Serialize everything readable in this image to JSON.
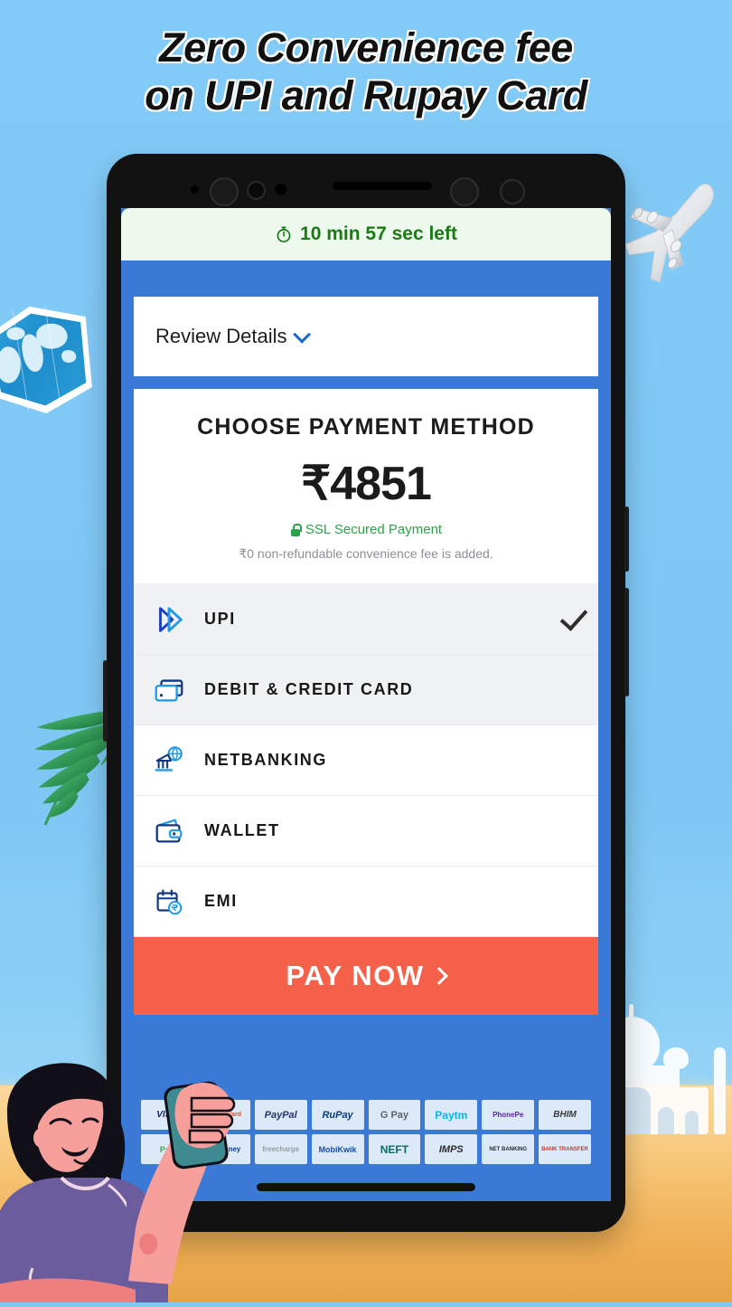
{
  "poster": {
    "headline_line1": "Zero Convenience fee",
    "headline_line2": "on UPI and Rupay Card",
    "background_color": "#80c9f5",
    "sand_color": "#f0b055"
  },
  "decorations": [
    {
      "name": "airplane",
      "color": "#ffffff"
    },
    {
      "name": "world-map",
      "color": "#2a9ed6"
    },
    {
      "name": "palm-leaf",
      "color": "#2e9e55"
    },
    {
      "name": "taj-mahal",
      "color": "#ffffff"
    },
    {
      "name": "woman-with-phone",
      "color": "#f49a9a"
    }
  ],
  "app": {
    "background_color": "#3a7ad6",
    "timer": {
      "icon": "stopwatch-icon",
      "text": "10 min 57 sec left",
      "text_color": "#1a7a14",
      "background_color": "#edf9ec"
    },
    "review": {
      "label": "Review Details",
      "chevron": "chevron-down-icon"
    },
    "payment": {
      "title": "CHOOSE PAYMENT METHOD",
      "amount": "₹4851",
      "ssl_text": "SSL Secured Payment",
      "ssl_color": "#2aa34a",
      "ssl_icon": "lock-icon",
      "fee_note": "₹0 non-refundable convenience fee is added."
    },
    "methods": [
      {
        "label": "UPI",
        "icon": "upi-icon",
        "selected": true,
        "check": "check-icon"
      },
      {
        "label": "DEBIT & CREDIT CARD",
        "icon": "credit-card-icon",
        "selected": true,
        "check": ""
      },
      {
        "label": "NETBANKING",
        "icon": "netbanking-icon",
        "selected": false,
        "check": ""
      },
      {
        "label": "WALLET",
        "icon": "wallet-icon",
        "selected": false,
        "check": ""
      },
      {
        "label": "EMI",
        "icon": "emi-calendar-icon",
        "selected": false,
        "check": ""
      }
    ],
    "pay_button": {
      "label": "PAY NOW",
      "chevron": "chevron-right-icon",
      "color": "#f4604a"
    },
    "logos_row1": [
      "VISA",
      "MasterCard",
      "PayPal",
      "RuPay",
      "G Pay",
      "Paytm",
      "PhonePe",
      "BHIM"
    ],
    "logos_row2": [
      "Pay",
      "JioMoney",
      "freecharge",
      "MobiKwik",
      "NEFT",
      "IMPS",
      "NET BANKING",
      "BANK TRANSFER"
    ]
  }
}
